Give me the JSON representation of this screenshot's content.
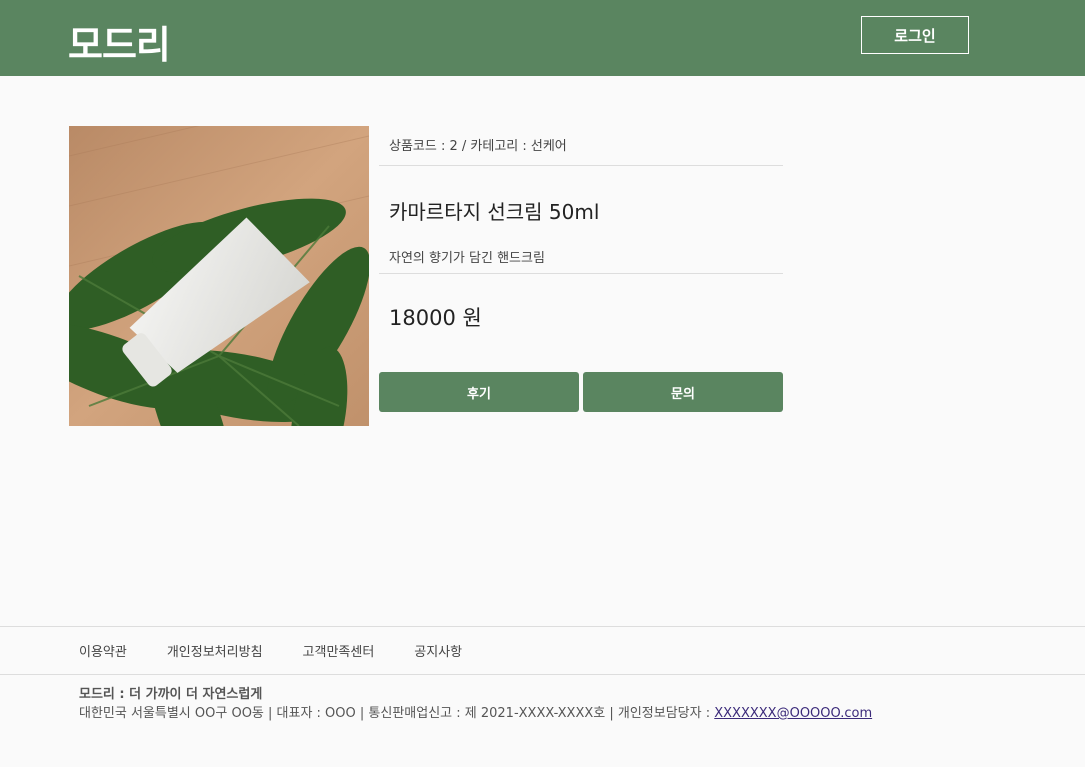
{
  "header": {
    "logo": "모드리",
    "login_label": "로그인"
  },
  "product": {
    "meta_code_label": "상품코드 : 2 / 카테고리 : 선케어",
    "name": "카마르타지 선크림 50ml",
    "description": "자연의 향기가 담긴 핸드크림",
    "price": "18000 원",
    "review_label": "후기",
    "inquiry_label": "문의"
  },
  "footer": {
    "nav": [
      "이용약관",
      "개인정보처리방침",
      "고객만족센터",
      "공지사항"
    ],
    "slogan": "모드리 : 더 가까이 더 자연스럽게",
    "info_text": "대한민국 서울특별시 OO구 OO동 | 대표자 : OOO | 통신판매업신고 : 제 2021-XXXX-XXXX호 | 개인정보담당자 : ",
    "email": "XXXXXXX@OOOOO.com"
  },
  "colors": {
    "brand_green": "#5a8560",
    "background": "#fafafa"
  }
}
